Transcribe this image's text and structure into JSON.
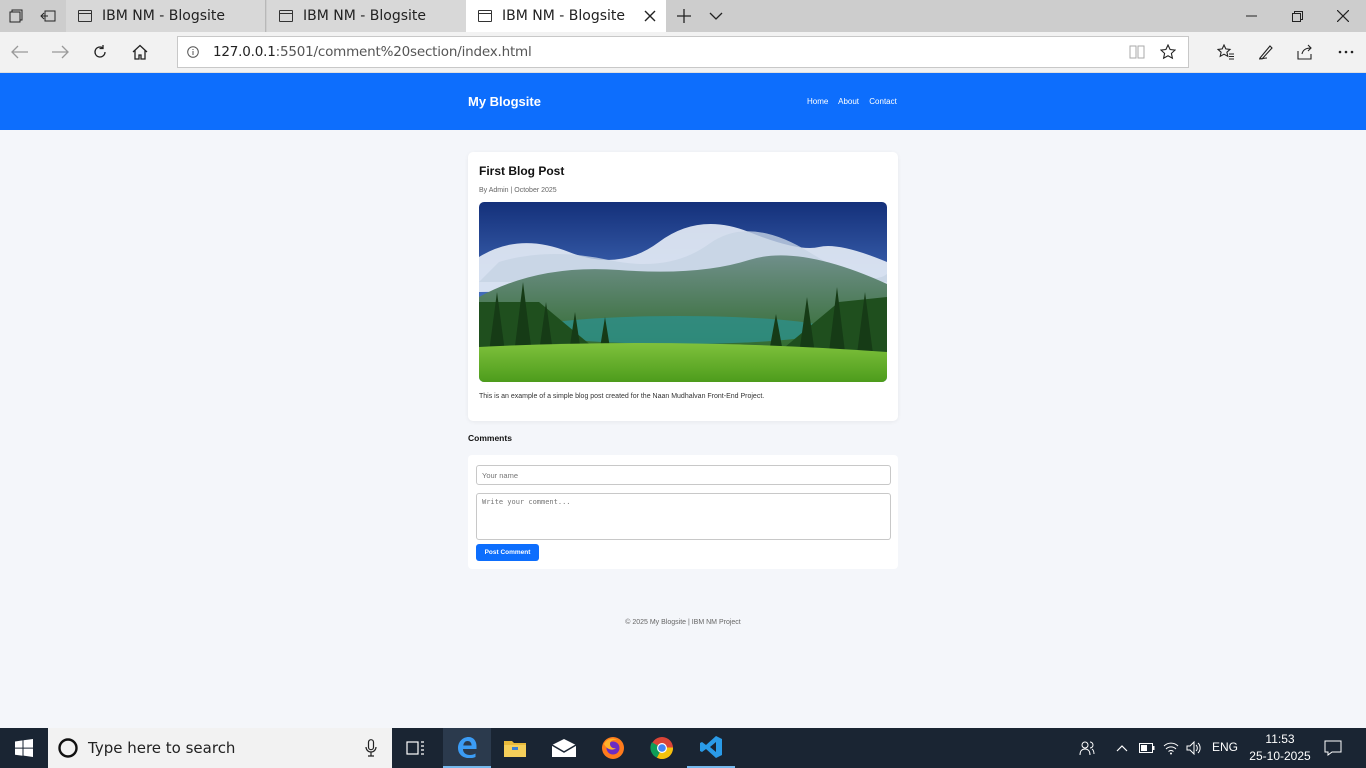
{
  "browser": {
    "tabs": [
      {
        "title": "IBM NM - Blogsite",
        "active": false
      },
      {
        "title": "IBM NM - Blogsite",
        "active": false
      },
      {
        "title": "IBM NM - Blogsite",
        "active": true
      }
    ],
    "url_host": "127.0.0.1",
    "url_rest": ":5501/comment%20section/index.html"
  },
  "site": {
    "brand": "My Blogsite",
    "nav": [
      "Home",
      "About",
      "Contact"
    ],
    "header_color": "#0d6efd"
  },
  "post": {
    "title": "First Blog Post",
    "meta": "By Admin | October 2025",
    "body": "This is an example of a simple blog post created for the Naan Mudhalvan Front-End Project."
  },
  "comments": {
    "heading": "Comments",
    "name_placeholder": "Your name",
    "comment_placeholder": "Write your comment...",
    "submit_label": "Post Comment"
  },
  "footer": "© 2025 My Blogsite | IBM NM Project",
  "taskbar": {
    "search_placeholder": "Type here to search",
    "language": "ENG",
    "time": "11:53",
    "date": "25-10-2025"
  }
}
